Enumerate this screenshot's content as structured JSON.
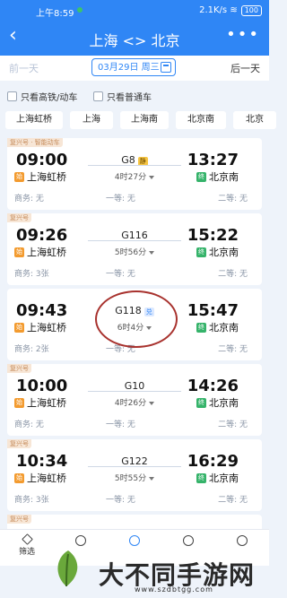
{
  "status": {
    "time": "上午8:59",
    "right": "2.1K/s",
    "battery": "100"
  },
  "nav": {
    "title": "上海 <> 北京"
  },
  "dates": {
    "prev": "前一天",
    "current": "03月29日 周三",
    "next": "后一天"
  },
  "filters": [
    "只看高铁/动车",
    "只看普通车"
  ],
  "stations": [
    "上海虹桥",
    "上海",
    "上海南",
    "北京南",
    "北京"
  ],
  "trains": [
    {
      "badge": "复兴号 · 智能动车",
      "dep": "09:00",
      "arr": "13:27",
      "from": "上海虹桥",
      "to": "北京南",
      "code": "G8",
      "code_badge": "静",
      "code_badge_style": "yellow",
      "duration": "4时27分",
      "seats": [
        "商务: 无",
        "一等: 无",
        "二等: 无"
      ]
    },
    {
      "badge": "复兴号",
      "dep": "09:26",
      "arr": "15:22",
      "from": "上海虹桥",
      "to": "北京南",
      "code": "G116",
      "code_badge": "",
      "code_badge_style": "",
      "duration": "5时56分",
      "seats": [
        "商务: 3张",
        "一等: 无",
        "二等: 无"
      ]
    },
    {
      "badge": "",
      "dep": "09:43",
      "arr": "15:47",
      "from": "上海虹桥",
      "to": "北京南",
      "code": "G118",
      "code_badge": "兑",
      "code_badge_style": "blue",
      "duration": "6时4分",
      "seats": [
        "商务: 2张",
        "一等: 无",
        "二等: 无"
      ]
    },
    {
      "badge": "复兴号",
      "dep": "10:00",
      "arr": "14:26",
      "from": "上海虹桥",
      "to": "北京南",
      "code": "G10",
      "code_badge": "",
      "code_badge_style": "",
      "duration": "4时26分",
      "seats": [
        "商务: 无",
        "一等: 无",
        "二等: 无"
      ]
    },
    {
      "badge": "复兴号",
      "dep": "10:34",
      "arr": "16:29",
      "from": "上海虹桥",
      "to": "北京南",
      "code": "G122",
      "code_badge": "",
      "code_badge_style": "",
      "duration": "5时55分",
      "seats": [
        "商务: 3张",
        "一等: 无",
        "二等: 无"
      ]
    }
  ],
  "partial_badge": "复兴号",
  "bottom_tabs": [
    "筛选"
  ],
  "watermark": {
    "text": "大不同手游网",
    "url": "www.szdbtgg.com"
  }
}
